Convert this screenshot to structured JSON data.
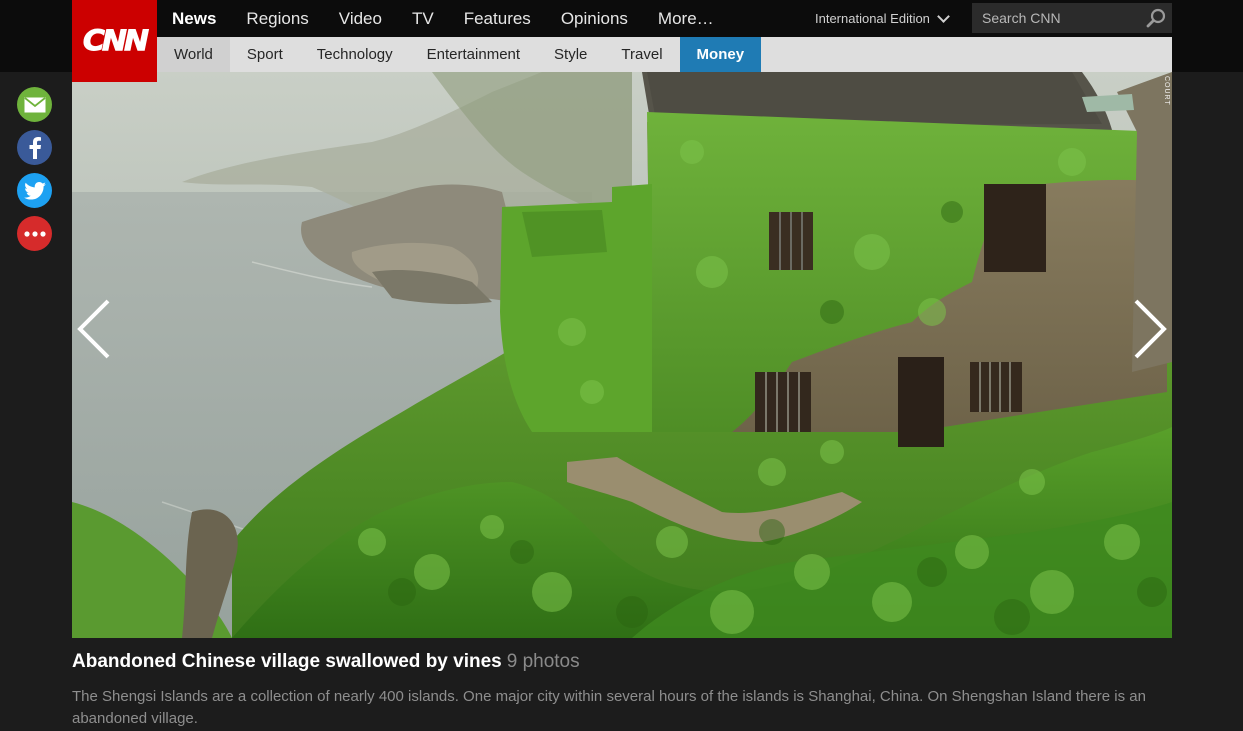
{
  "header": {
    "logo": "CNN",
    "main_nav": [
      {
        "label": "News",
        "active": true
      },
      {
        "label": "Regions",
        "active": false
      },
      {
        "label": "Video",
        "active": false
      },
      {
        "label": "TV",
        "active": false
      },
      {
        "label": "Features",
        "active": false
      },
      {
        "label": "Opinions",
        "active": false
      },
      {
        "label": "More…",
        "active": false
      }
    ],
    "edition": "International Edition",
    "search_placeholder": "Search CNN",
    "sub_nav": [
      {
        "label": "World",
        "active": false
      },
      {
        "label": "Sport",
        "active": false
      },
      {
        "label": "Technology",
        "active": false
      },
      {
        "label": "Entertainment",
        "active": false
      },
      {
        "label": "Style",
        "active": false
      },
      {
        "label": "Travel",
        "active": false
      },
      {
        "label": "Money",
        "active": true
      }
    ]
  },
  "social": [
    {
      "name": "email",
      "icon": "envelope-icon",
      "color": "#6fb33c"
    },
    {
      "name": "facebook",
      "icon": "facebook-icon",
      "color": "#3a5a99"
    },
    {
      "name": "twitter",
      "icon": "twitter-bird-icon",
      "color": "#1da1f2"
    },
    {
      "name": "more",
      "icon": "more-dots-icon",
      "color": "#d62b2b"
    }
  ],
  "gallery": {
    "image_credit": "COURT",
    "prev_icon": "chevron-left-icon",
    "next_icon": "chevron-right-icon"
  },
  "caption": {
    "title": "Abandoned Chinese village swallowed by vines",
    "photo_count": "9 photos",
    "description": "The Shengsi Islands are a collection of nearly 400 islands. One major city within several hours of the islands is Shanghai, China. On Shengshan Island there is an abandoned village."
  },
  "colors": {
    "brand_red": "#cc0000",
    "active_tab": "#1f7bb4",
    "page_bg": "#1c1c1c"
  }
}
